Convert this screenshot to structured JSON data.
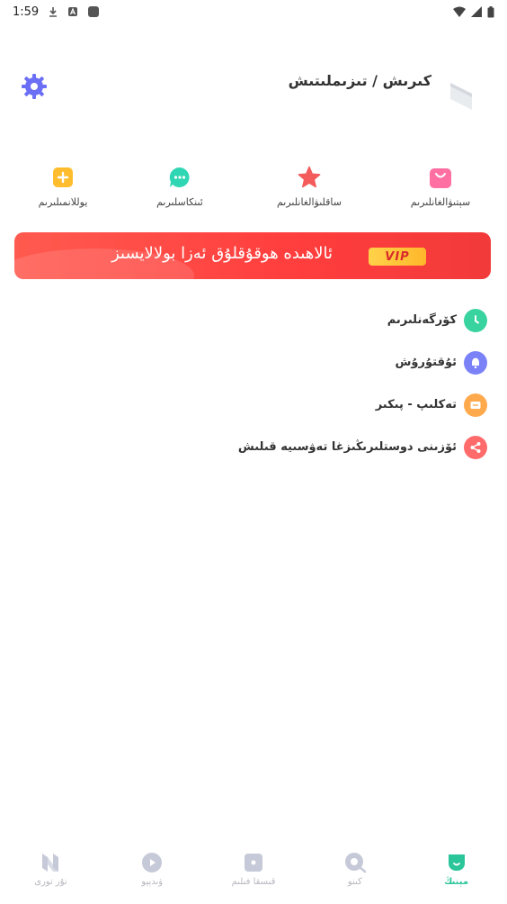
{
  "status_bar": {
    "time": "1:59",
    "left_icons": [
      "download-icon",
      "font-icon",
      "square-icon"
    ],
    "right_icons": [
      "wifi-icon",
      "signal-icon",
      "battery-icon"
    ]
  },
  "header": {
    "title": "كىرىش / تىزىملىتىش",
    "settings_icon": "gear-icon",
    "settings_color": "#6b6ff5"
  },
  "quick_actions": [
    {
      "label": "سېتىۋالغانلىرىم",
      "icon": "shopping-bag-icon",
      "color": "#ff6fa1"
    },
    {
      "label": "ساقلىۋالغانلىرىم",
      "icon": "star-icon",
      "color": "#f45b5b"
    },
    {
      "label": "ئىنكاسلىرىم",
      "icon": "chat-icon",
      "color": "#2fd6b3"
    },
    {
      "label": "يوللانمىلىرىم",
      "icon": "plus-icon",
      "color": "#ffbd2e"
    }
  ],
  "vip_banner": {
    "text": "ئالاھىدە ھوقۇقلۇق ئەزا بولالايسىز",
    "badge": "VIP"
  },
  "menu": [
    {
      "label": "كۆرگەنلىرىم",
      "icon": "clock-icon",
      "color": "#38d39f"
    },
    {
      "label": "ئۇقتۇرۇش",
      "icon": "bell-icon",
      "color": "#7b82f7"
    },
    {
      "label": "تەكلىپ - پىكىر",
      "icon": "message-icon",
      "color": "#ffa94d"
    },
    {
      "label": "ئۆزىنى دوستلىرىڭىزغا تەۋسىيە قىلىش",
      "icon": "share-icon",
      "color": "#ff6b6b"
    }
  ],
  "bottom_nav": [
    {
      "label": "مېنىڭ",
      "icon": "profile-icon",
      "active": true
    },
    {
      "label": "كىنو",
      "icon": "search-film-icon",
      "active": false
    },
    {
      "label": "قىسقا فىلىم",
      "icon": "short-film-icon",
      "active": false
    },
    {
      "label": "ۋىدېيو",
      "icon": "play-icon",
      "active": false
    },
    {
      "label": "نۇر تورى",
      "icon": "logo-icon",
      "active": false
    }
  ]
}
